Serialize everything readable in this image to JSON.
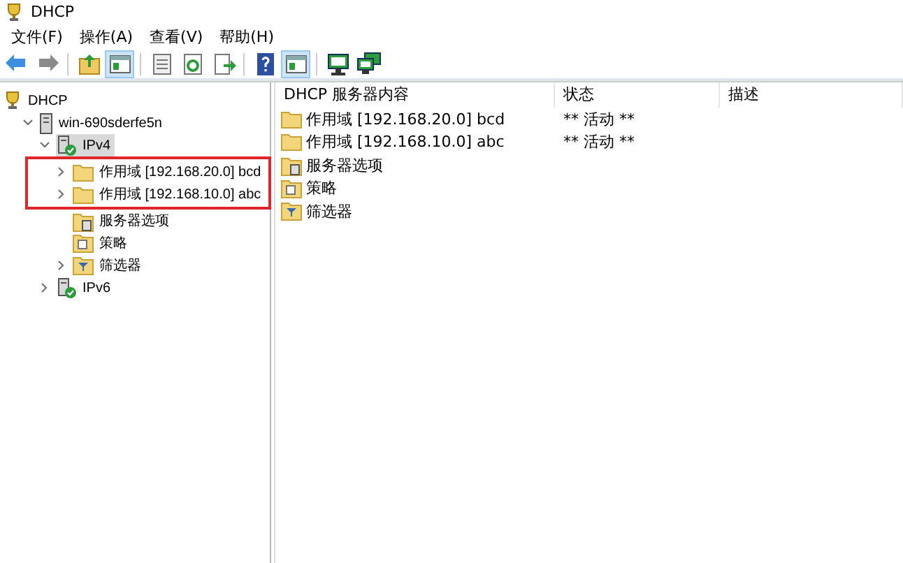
{
  "window": {
    "title": "DHCP"
  },
  "menu": [
    "文件(F)",
    "操作(A)",
    "查看(V)",
    "帮助(H)"
  ],
  "toolbar": [
    {
      "kind": "back",
      "selected": false
    },
    {
      "kind": "forward",
      "selected": false
    },
    {
      "kind": "sep"
    },
    {
      "kind": "up",
      "selected": false
    },
    {
      "kind": "tree",
      "selected": true
    },
    {
      "kind": "sep"
    },
    {
      "kind": "props",
      "selected": false
    },
    {
      "kind": "refresh",
      "selected": false
    },
    {
      "kind": "export",
      "selected": false
    },
    {
      "kind": "sep"
    },
    {
      "kind": "help",
      "selected": false
    },
    {
      "kind": "tree",
      "selected": true
    },
    {
      "kind": "sep"
    },
    {
      "kind": "monitor",
      "selected": false
    },
    {
      "kind": "monitor2",
      "selected": false
    }
  ],
  "tree": [
    {
      "label": "DHCP",
      "kind": "trophy",
      "selected": false,
      "children": [
        {
          "label": "win-690sderfe5n",
          "kind": "server",
          "expanded": true,
          "selected": false,
          "children": [
            {
              "label": "IPv4",
              "kind": "net",
              "expanded": true,
              "selected": true,
              "children": [
                {
                  "label": "作用域 [192.168.20.0] bcd",
                  "kind": "folder",
                  "expanded": false,
                  "selected": false,
                  "highlighted": true
                },
                {
                  "label": "作用域 [192.168.10.0] abc",
                  "kind": "folder",
                  "expanded": false,
                  "selected": false,
                  "highlighted": true
                },
                {
                  "label": "服务器选项",
                  "kind": "options",
                  "selected": false,
                  "highlighted": false
                },
                {
                  "label": "策略",
                  "kind": "policy",
                  "selected": false,
                  "highlighted": false
                },
                {
                  "label": "筛选器",
                  "kind": "filter",
                  "expanded": false,
                  "selected": false,
                  "highlighted": false
                }
              ]
            },
            {
              "label": "IPv6",
              "kind": "net",
              "expanded": false,
              "selected": false
            }
          ]
        }
      ]
    }
  ],
  "list": {
    "columns": [
      "DHCP 服务器内容",
      "状态",
      "描述"
    ],
    "rows": [
      {
        "kind": "folder",
        "name": "作用域 [192.168.20.0] bcd",
        "status": "** 活动 **"
      },
      {
        "kind": "folder",
        "name": "作用域 [192.168.10.0] abc",
        "status": "** 活动 **"
      },
      {
        "kind": "options",
        "name": "服务器选项"
      },
      {
        "kind": "policy",
        "name": "策略"
      },
      {
        "kind": "filter",
        "name": "筛选器"
      }
    ]
  }
}
